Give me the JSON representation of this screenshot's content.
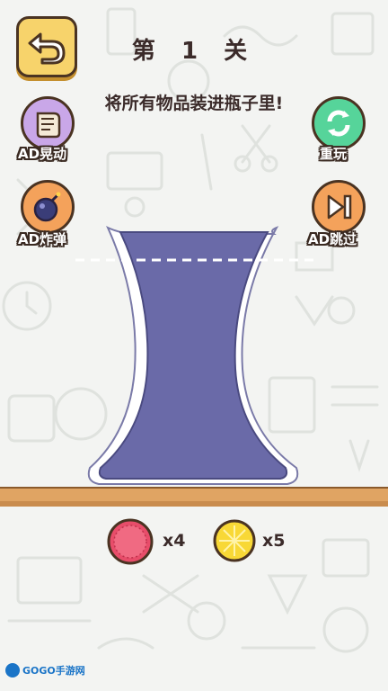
{
  "level": {
    "title": "第 1 关"
  },
  "instruction": "将所有物品装进瓶子里!",
  "buttons": {
    "back": {
      "icon": "back-arrow-icon"
    },
    "shake": {
      "label": "AD晃动",
      "icon": "scroll-icon",
      "color": "#c9a7e8"
    },
    "replay": {
      "label": "重玩",
      "icon": "refresh-icon",
      "color": "#56d49a"
    },
    "bomb": {
      "label": "AD炸弹",
      "icon": "bomb-icon",
      "color": "#f4a25b"
    },
    "skip": {
      "label": "AD跳过",
      "icon": "skip-forward-icon",
      "color": "#f4a25b"
    }
  },
  "items": [
    {
      "name": "watermelon",
      "icon": "watermelon-icon",
      "count_text": "x4",
      "color": "#e84d6a"
    },
    {
      "name": "lemon",
      "icon": "lemon-icon",
      "count_text": "x5",
      "color": "#f8d836"
    }
  ],
  "vase": {
    "fill_color": "#6a6aa8"
  },
  "watermark": {
    "text": "GOGO手游网"
  }
}
